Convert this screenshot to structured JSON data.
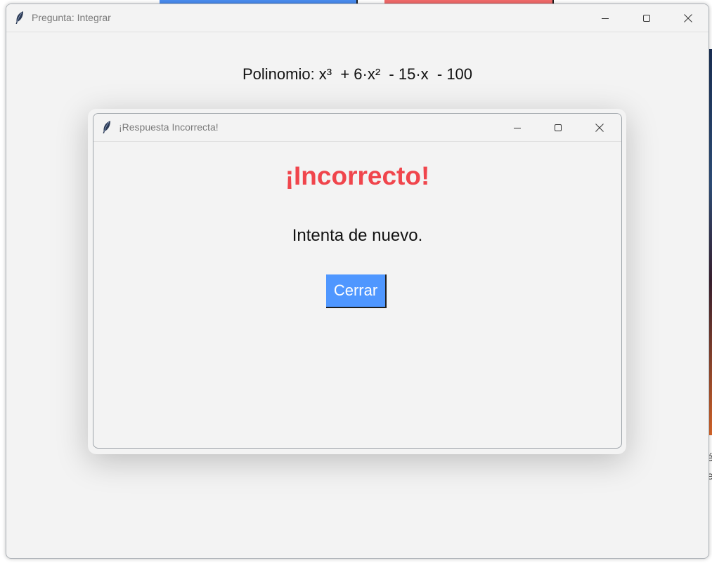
{
  "main_window": {
    "title": "Pregunta: Integrar",
    "polynomial_text": "Polinomio: x³  + 6·x²  - 15·x  - 100"
  },
  "dialog": {
    "title": "¡Respuesta Incorrecta!",
    "heading": "¡Incorrecto!",
    "message": "Intenta de nuevo.",
    "close_button_label": "Cerrar"
  },
  "background": {
    "right_edge_text": "é\ne"
  },
  "icons": {
    "app": "feather-icon",
    "minimize": "minimize-icon",
    "maximize": "maximize-icon",
    "close": "close-icon"
  },
  "colors": {
    "heading": "#f0454c",
    "button_bg": "#4f97ff",
    "button_text": "#ffffff",
    "window_bg": "#f3f3f3"
  }
}
